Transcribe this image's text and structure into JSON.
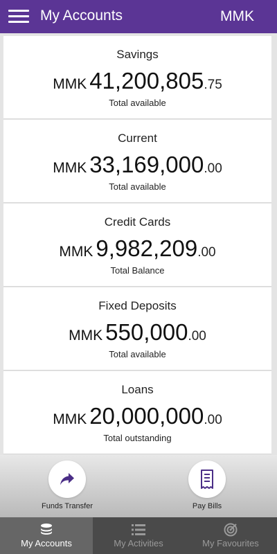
{
  "header": {
    "title": "My Accounts",
    "currency": "MMK"
  },
  "accounts": [
    {
      "title": "Savings",
      "currency": "MMK",
      "amount": "41,200,805",
      "cents": ".75",
      "subtitle": "Total available"
    },
    {
      "title": "Current",
      "currency": "MMK",
      "amount": "33,169,000",
      "cents": ".00",
      "subtitle": "Total available"
    },
    {
      "title": "Credit Cards",
      "currency": "MMK",
      "amount": "9,982,209",
      "cents": ".00",
      "subtitle": "Total Balance"
    },
    {
      "title": "Fixed Deposits",
      "currency": "MMK",
      "amount": "550,000",
      "cents": ".00",
      "subtitle": "Total available"
    },
    {
      "title": "Loans",
      "currency": "MMK",
      "amount": "20,000,000",
      "cents": ".00",
      "subtitle": "Total outstanding"
    }
  ],
  "quick_actions": [
    {
      "label": "Funds Transfer",
      "icon": "share-arrow-icon"
    },
    {
      "label": "Pay Bills",
      "icon": "receipt-icon"
    }
  ],
  "tabs": [
    {
      "label": "My Accounts",
      "icon": "coins-stack-icon",
      "active": true
    },
    {
      "label": "My Activities",
      "icon": "list-icon",
      "active": false
    },
    {
      "label": "My Favourites",
      "icon": "target-icon",
      "active": false
    }
  ],
  "colors": {
    "brand": "#5b3595",
    "tabbar": "#4a4a4a",
    "tab_active": "#666666"
  }
}
